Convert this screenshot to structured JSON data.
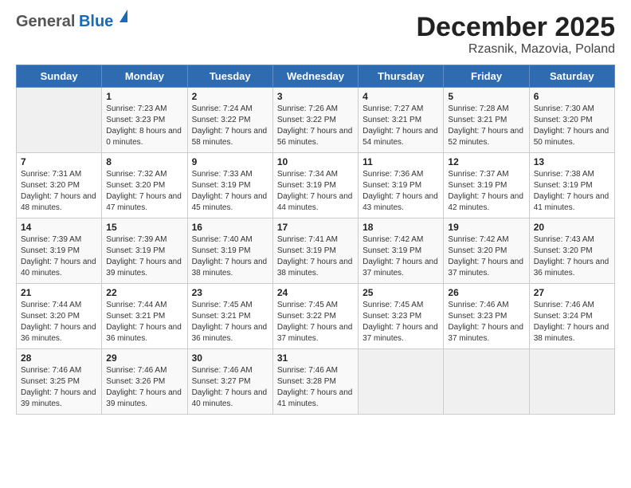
{
  "logo": {
    "general": "General",
    "blue": "Blue"
  },
  "title": "December 2025",
  "subtitle": "Rzasnik, Mazovia, Poland",
  "weekdays": [
    "Sunday",
    "Monday",
    "Tuesday",
    "Wednesday",
    "Thursday",
    "Friday",
    "Saturday"
  ],
  "weeks": [
    [
      {
        "day": "",
        "sunrise": "",
        "sunset": "",
        "daylight": ""
      },
      {
        "day": "1",
        "sunrise": "Sunrise: 7:23 AM",
        "sunset": "Sunset: 3:23 PM",
        "daylight": "Daylight: 8 hours and 0 minutes."
      },
      {
        "day": "2",
        "sunrise": "Sunrise: 7:24 AM",
        "sunset": "Sunset: 3:22 PM",
        "daylight": "Daylight: 7 hours and 58 minutes."
      },
      {
        "day": "3",
        "sunrise": "Sunrise: 7:26 AM",
        "sunset": "Sunset: 3:22 PM",
        "daylight": "Daylight: 7 hours and 56 minutes."
      },
      {
        "day": "4",
        "sunrise": "Sunrise: 7:27 AM",
        "sunset": "Sunset: 3:21 PM",
        "daylight": "Daylight: 7 hours and 54 minutes."
      },
      {
        "day": "5",
        "sunrise": "Sunrise: 7:28 AM",
        "sunset": "Sunset: 3:21 PM",
        "daylight": "Daylight: 7 hours and 52 minutes."
      },
      {
        "day": "6",
        "sunrise": "Sunrise: 7:30 AM",
        "sunset": "Sunset: 3:20 PM",
        "daylight": "Daylight: 7 hours and 50 minutes."
      }
    ],
    [
      {
        "day": "7",
        "sunrise": "Sunrise: 7:31 AM",
        "sunset": "Sunset: 3:20 PM",
        "daylight": "Daylight: 7 hours and 48 minutes."
      },
      {
        "day": "8",
        "sunrise": "Sunrise: 7:32 AM",
        "sunset": "Sunset: 3:20 PM",
        "daylight": "Daylight: 7 hours and 47 minutes."
      },
      {
        "day": "9",
        "sunrise": "Sunrise: 7:33 AM",
        "sunset": "Sunset: 3:19 PM",
        "daylight": "Daylight: 7 hours and 45 minutes."
      },
      {
        "day": "10",
        "sunrise": "Sunrise: 7:34 AM",
        "sunset": "Sunset: 3:19 PM",
        "daylight": "Daylight: 7 hours and 44 minutes."
      },
      {
        "day": "11",
        "sunrise": "Sunrise: 7:36 AM",
        "sunset": "Sunset: 3:19 PM",
        "daylight": "Daylight: 7 hours and 43 minutes."
      },
      {
        "day": "12",
        "sunrise": "Sunrise: 7:37 AM",
        "sunset": "Sunset: 3:19 PM",
        "daylight": "Daylight: 7 hours and 42 minutes."
      },
      {
        "day": "13",
        "sunrise": "Sunrise: 7:38 AM",
        "sunset": "Sunset: 3:19 PM",
        "daylight": "Daylight: 7 hours and 41 minutes."
      }
    ],
    [
      {
        "day": "14",
        "sunrise": "Sunrise: 7:39 AM",
        "sunset": "Sunset: 3:19 PM",
        "daylight": "Daylight: 7 hours and 40 minutes."
      },
      {
        "day": "15",
        "sunrise": "Sunrise: 7:39 AM",
        "sunset": "Sunset: 3:19 PM",
        "daylight": "Daylight: 7 hours and 39 minutes."
      },
      {
        "day": "16",
        "sunrise": "Sunrise: 7:40 AM",
        "sunset": "Sunset: 3:19 PM",
        "daylight": "Daylight: 7 hours and 38 minutes."
      },
      {
        "day": "17",
        "sunrise": "Sunrise: 7:41 AM",
        "sunset": "Sunset: 3:19 PM",
        "daylight": "Daylight: 7 hours and 38 minutes."
      },
      {
        "day": "18",
        "sunrise": "Sunrise: 7:42 AM",
        "sunset": "Sunset: 3:19 PM",
        "daylight": "Daylight: 7 hours and 37 minutes."
      },
      {
        "day": "19",
        "sunrise": "Sunrise: 7:42 AM",
        "sunset": "Sunset: 3:20 PM",
        "daylight": "Daylight: 7 hours and 37 minutes."
      },
      {
        "day": "20",
        "sunrise": "Sunrise: 7:43 AM",
        "sunset": "Sunset: 3:20 PM",
        "daylight": "Daylight: 7 hours and 36 minutes."
      }
    ],
    [
      {
        "day": "21",
        "sunrise": "Sunrise: 7:44 AM",
        "sunset": "Sunset: 3:20 PM",
        "daylight": "Daylight: 7 hours and 36 minutes."
      },
      {
        "day": "22",
        "sunrise": "Sunrise: 7:44 AM",
        "sunset": "Sunset: 3:21 PM",
        "daylight": "Daylight: 7 hours and 36 minutes."
      },
      {
        "day": "23",
        "sunrise": "Sunrise: 7:45 AM",
        "sunset": "Sunset: 3:21 PM",
        "daylight": "Daylight: 7 hours and 36 minutes."
      },
      {
        "day": "24",
        "sunrise": "Sunrise: 7:45 AM",
        "sunset": "Sunset: 3:22 PM",
        "daylight": "Daylight: 7 hours and 37 minutes."
      },
      {
        "day": "25",
        "sunrise": "Sunrise: 7:45 AM",
        "sunset": "Sunset: 3:23 PM",
        "daylight": "Daylight: 7 hours and 37 minutes."
      },
      {
        "day": "26",
        "sunrise": "Sunrise: 7:46 AM",
        "sunset": "Sunset: 3:23 PM",
        "daylight": "Daylight: 7 hours and 37 minutes."
      },
      {
        "day": "27",
        "sunrise": "Sunrise: 7:46 AM",
        "sunset": "Sunset: 3:24 PM",
        "daylight": "Daylight: 7 hours and 38 minutes."
      }
    ],
    [
      {
        "day": "28",
        "sunrise": "Sunrise: 7:46 AM",
        "sunset": "Sunset: 3:25 PM",
        "daylight": "Daylight: 7 hours and 39 minutes."
      },
      {
        "day": "29",
        "sunrise": "Sunrise: 7:46 AM",
        "sunset": "Sunset: 3:26 PM",
        "daylight": "Daylight: 7 hours and 39 minutes."
      },
      {
        "day": "30",
        "sunrise": "Sunrise: 7:46 AM",
        "sunset": "Sunset: 3:27 PM",
        "daylight": "Daylight: 7 hours and 40 minutes."
      },
      {
        "day": "31",
        "sunrise": "Sunrise: 7:46 AM",
        "sunset": "Sunset: 3:28 PM",
        "daylight": "Daylight: 7 hours and 41 minutes."
      },
      {
        "day": "",
        "sunrise": "",
        "sunset": "",
        "daylight": ""
      },
      {
        "day": "",
        "sunrise": "",
        "sunset": "",
        "daylight": ""
      },
      {
        "day": "",
        "sunrise": "",
        "sunset": "",
        "daylight": ""
      }
    ]
  ]
}
